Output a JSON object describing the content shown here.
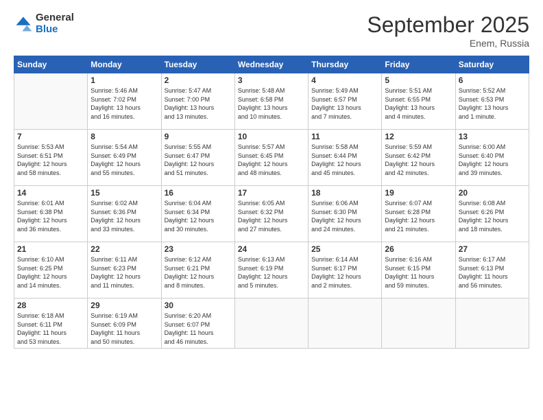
{
  "header": {
    "logo": {
      "general": "General",
      "blue": "Blue"
    },
    "title": "September 2025",
    "location": "Enem, Russia"
  },
  "days_header": [
    "Sunday",
    "Monday",
    "Tuesday",
    "Wednesday",
    "Thursday",
    "Friday",
    "Saturday"
  ],
  "weeks": [
    [
      {
        "num": "",
        "info": ""
      },
      {
        "num": "1",
        "info": "Sunrise: 5:46 AM\nSunset: 7:02 PM\nDaylight: 13 hours\nand 16 minutes."
      },
      {
        "num": "2",
        "info": "Sunrise: 5:47 AM\nSunset: 7:00 PM\nDaylight: 13 hours\nand 13 minutes."
      },
      {
        "num": "3",
        "info": "Sunrise: 5:48 AM\nSunset: 6:58 PM\nDaylight: 13 hours\nand 10 minutes."
      },
      {
        "num": "4",
        "info": "Sunrise: 5:49 AM\nSunset: 6:57 PM\nDaylight: 13 hours\nand 7 minutes."
      },
      {
        "num": "5",
        "info": "Sunrise: 5:51 AM\nSunset: 6:55 PM\nDaylight: 13 hours\nand 4 minutes."
      },
      {
        "num": "6",
        "info": "Sunrise: 5:52 AM\nSunset: 6:53 PM\nDaylight: 13 hours\nand 1 minute."
      }
    ],
    [
      {
        "num": "7",
        "info": "Sunrise: 5:53 AM\nSunset: 6:51 PM\nDaylight: 12 hours\nand 58 minutes."
      },
      {
        "num": "8",
        "info": "Sunrise: 5:54 AM\nSunset: 6:49 PM\nDaylight: 12 hours\nand 55 minutes."
      },
      {
        "num": "9",
        "info": "Sunrise: 5:55 AM\nSunset: 6:47 PM\nDaylight: 12 hours\nand 51 minutes."
      },
      {
        "num": "10",
        "info": "Sunrise: 5:57 AM\nSunset: 6:45 PM\nDaylight: 12 hours\nand 48 minutes."
      },
      {
        "num": "11",
        "info": "Sunrise: 5:58 AM\nSunset: 6:44 PM\nDaylight: 12 hours\nand 45 minutes."
      },
      {
        "num": "12",
        "info": "Sunrise: 5:59 AM\nSunset: 6:42 PM\nDaylight: 12 hours\nand 42 minutes."
      },
      {
        "num": "13",
        "info": "Sunrise: 6:00 AM\nSunset: 6:40 PM\nDaylight: 12 hours\nand 39 minutes."
      }
    ],
    [
      {
        "num": "14",
        "info": "Sunrise: 6:01 AM\nSunset: 6:38 PM\nDaylight: 12 hours\nand 36 minutes."
      },
      {
        "num": "15",
        "info": "Sunrise: 6:02 AM\nSunset: 6:36 PM\nDaylight: 12 hours\nand 33 minutes."
      },
      {
        "num": "16",
        "info": "Sunrise: 6:04 AM\nSunset: 6:34 PM\nDaylight: 12 hours\nand 30 minutes."
      },
      {
        "num": "17",
        "info": "Sunrise: 6:05 AM\nSunset: 6:32 PM\nDaylight: 12 hours\nand 27 minutes."
      },
      {
        "num": "18",
        "info": "Sunrise: 6:06 AM\nSunset: 6:30 PM\nDaylight: 12 hours\nand 24 minutes."
      },
      {
        "num": "19",
        "info": "Sunrise: 6:07 AM\nSunset: 6:28 PM\nDaylight: 12 hours\nand 21 minutes."
      },
      {
        "num": "20",
        "info": "Sunrise: 6:08 AM\nSunset: 6:26 PM\nDaylight: 12 hours\nand 18 minutes."
      }
    ],
    [
      {
        "num": "21",
        "info": "Sunrise: 6:10 AM\nSunset: 6:25 PM\nDaylight: 12 hours\nand 14 minutes."
      },
      {
        "num": "22",
        "info": "Sunrise: 6:11 AM\nSunset: 6:23 PM\nDaylight: 12 hours\nand 11 minutes."
      },
      {
        "num": "23",
        "info": "Sunrise: 6:12 AM\nSunset: 6:21 PM\nDaylight: 12 hours\nand 8 minutes."
      },
      {
        "num": "24",
        "info": "Sunrise: 6:13 AM\nSunset: 6:19 PM\nDaylight: 12 hours\nand 5 minutes."
      },
      {
        "num": "25",
        "info": "Sunrise: 6:14 AM\nSunset: 6:17 PM\nDaylight: 12 hours\nand 2 minutes."
      },
      {
        "num": "26",
        "info": "Sunrise: 6:16 AM\nSunset: 6:15 PM\nDaylight: 11 hours\nand 59 minutes."
      },
      {
        "num": "27",
        "info": "Sunrise: 6:17 AM\nSunset: 6:13 PM\nDaylight: 11 hours\nand 56 minutes."
      }
    ],
    [
      {
        "num": "28",
        "info": "Sunrise: 6:18 AM\nSunset: 6:11 PM\nDaylight: 11 hours\nand 53 minutes."
      },
      {
        "num": "29",
        "info": "Sunrise: 6:19 AM\nSunset: 6:09 PM\nDaylight: 11 hours\nand 50 minutes."
      },
      {
        "num": "30",
        "info": "Sunrise: 6:20 AM\nSunset: 6:07 PM\nDaylight: 11 hours\nand 46 minutes."
      },
      {
        "num": "",
        "info": ""
      },
      {
        "num": "",
        "info": ""
      },
      {
        "num": "",
        "info": ""
      },
      {
        "num": "",
        "info": ""
      }
    ]
  ]
}
